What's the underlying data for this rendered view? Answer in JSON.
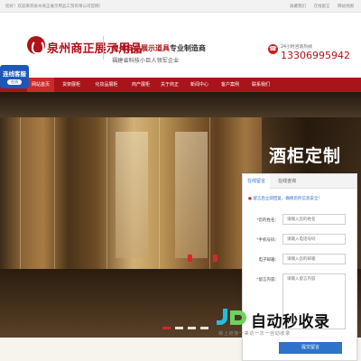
{
  "topbar": {
    "welcome": "您好！欢迎来到泉州商正展示用品工贸有限公司官网！",
    "links": [
      "收藏我们",
      "在线留言",
      "网站地图"
    ]
  },
  "header": {
    "logo_text": "泉州商正展示用品",
    "slogan_highlight": "泉州商业展示道具",
    "slogan_rest": "专业制造商",
    "slogan_line2": "福建省科技小巨人领军企业",
    "hotline_label": "24小时咨询热线",
    "hotline_number": "13306995942"
  },
  "service_float": {
    "title": "连线客服",
    "sub": "在线"
  },
  "nav": {
    "items": [
      "网站首页",
      "货架展柜",
      "化妆品展柜",
      "商产展柜",
      "关于商正",
      "新闻中心",
      "客户案例",
      "联系我们"
    ]
  },
  "banner": {
    "title": "酒柜定制"
  },
  "message_panel": {
    "tabs": [
      "在线留言",
      "在线咨询"
    ],
    "notice": "留言后立即回复，确保您的信息安全！",
    "fields": [
      {
        "label": "您的姓名：",
        "required": true,
        "placeholder": "请输入您的姓名"
      },
      {
        "label": "手机号码：",
        "required": true,
        "placeholder": "请输入电话号码"
      },
      {
        "label": "电子邮箱：",
        "required": false,
        "placeholder": "请输入您的邮箱"
      },
      {
        "label": "留言内容：",
        "required": true,
        "placeholder": "请输入留言内容"
      }
    ],
    "submit_label": "提交留言"
  },
  "watermark": {
    "title": "自动秒收录",
    "subtitle": "做上链接一来访一次一自动收录"
  },
  "colors": {
    "brand_red": "#a9141b",
    "accent_blue": "#2e72c9",
    "service_blue": "#1e57b8"
  }
}
